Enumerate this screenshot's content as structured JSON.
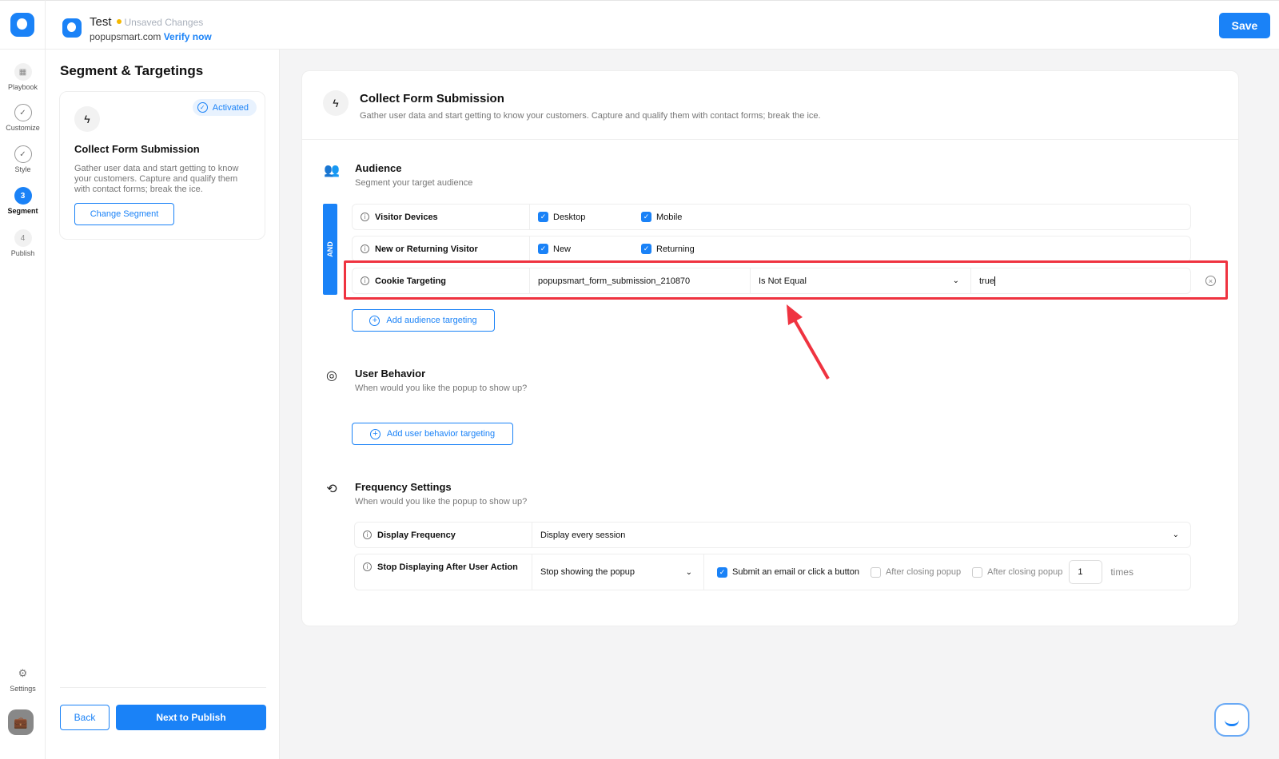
{
  "header": {
    "project": "Test",
    "status": "Unsaved Changes",
    "domain": "popupsmart.com",
    "verify": "Verify now",
    "save": "Save"
  },
  "nav": {
    "items": [
      {
        "label": "Playbook",
        "icon": "grid-icon",
        "state": "default"
      },
      {
        "label": "Customize",
        "icon": "check-icon",
        "state": "done"
      },
      {
        "label": "Style",
        "icon": "check-icon",
        "state": "done"
      },
      {
        "label": "Segment",
        "num": "3",
        "state": "active"
      },
      {
        "label": "Publish",
        "num": "4",
        "state": "default"
      }
    ],
    "settings": "Settings"
  },
  "left": {
    "title": "Segment & Targetings",
    "card": {
      "badge": "Activated",
      "title": "Collect Form Submission",
      "desc": "Gather user data and start getting to know your customers. Capture and qualify them with contact forms; break the ice.",
      "button": "Change Segment"
    },
    "back": "Back",
    "next": "Next to Publish"
  },
  "main": {
    "title": "Collect Form Submission",
    "desc": "Gather user data and start getting to know your customers. Capture and qualify them with contact forms; break the ice.",
    "audience": {
      "title": "Audience",
      "desc": "Segment your target audience",
      "and": "AND",
      "rows": [
        {
          "label": "Visitor Devices",
          "opts": [
            "Desktop",
            "Mobile"
          ]
        },
        {
          "label": "New or Returning Visitor",
          "opts": [
            "New",
            "Returning"
          ]
        }
      ],
      "cookie": {
        "label": "Cookie Targeting",
        "name": "popupsmart_form_submission_210870",
        "operator": "Is Not Equal",
        "value": "true"
      },
      "add": "Add audience targeting"
    },
    "behavior": {
      "title": "User Behavior",
      "desc": "When would you like the popup to show up?",
      "add": "Add user behavior targeting"
    },
    "frequency": {
      "title": "Frequency Settings",
      "desc": "When would you like the popup to show up?",
      "display_label": "Display Frequency",
      "display_value": "Display every session",
      "stop_label": "Stop Displaying After User Action",
      "stop_value": "Stop showing the popup",
      "opt1": "Submit an email or click a button",
      "opt2": "After closing popup",
      "opt3": "After closing popup",
      "times_value": "1",
      "times": "times"
    }
  }
}
